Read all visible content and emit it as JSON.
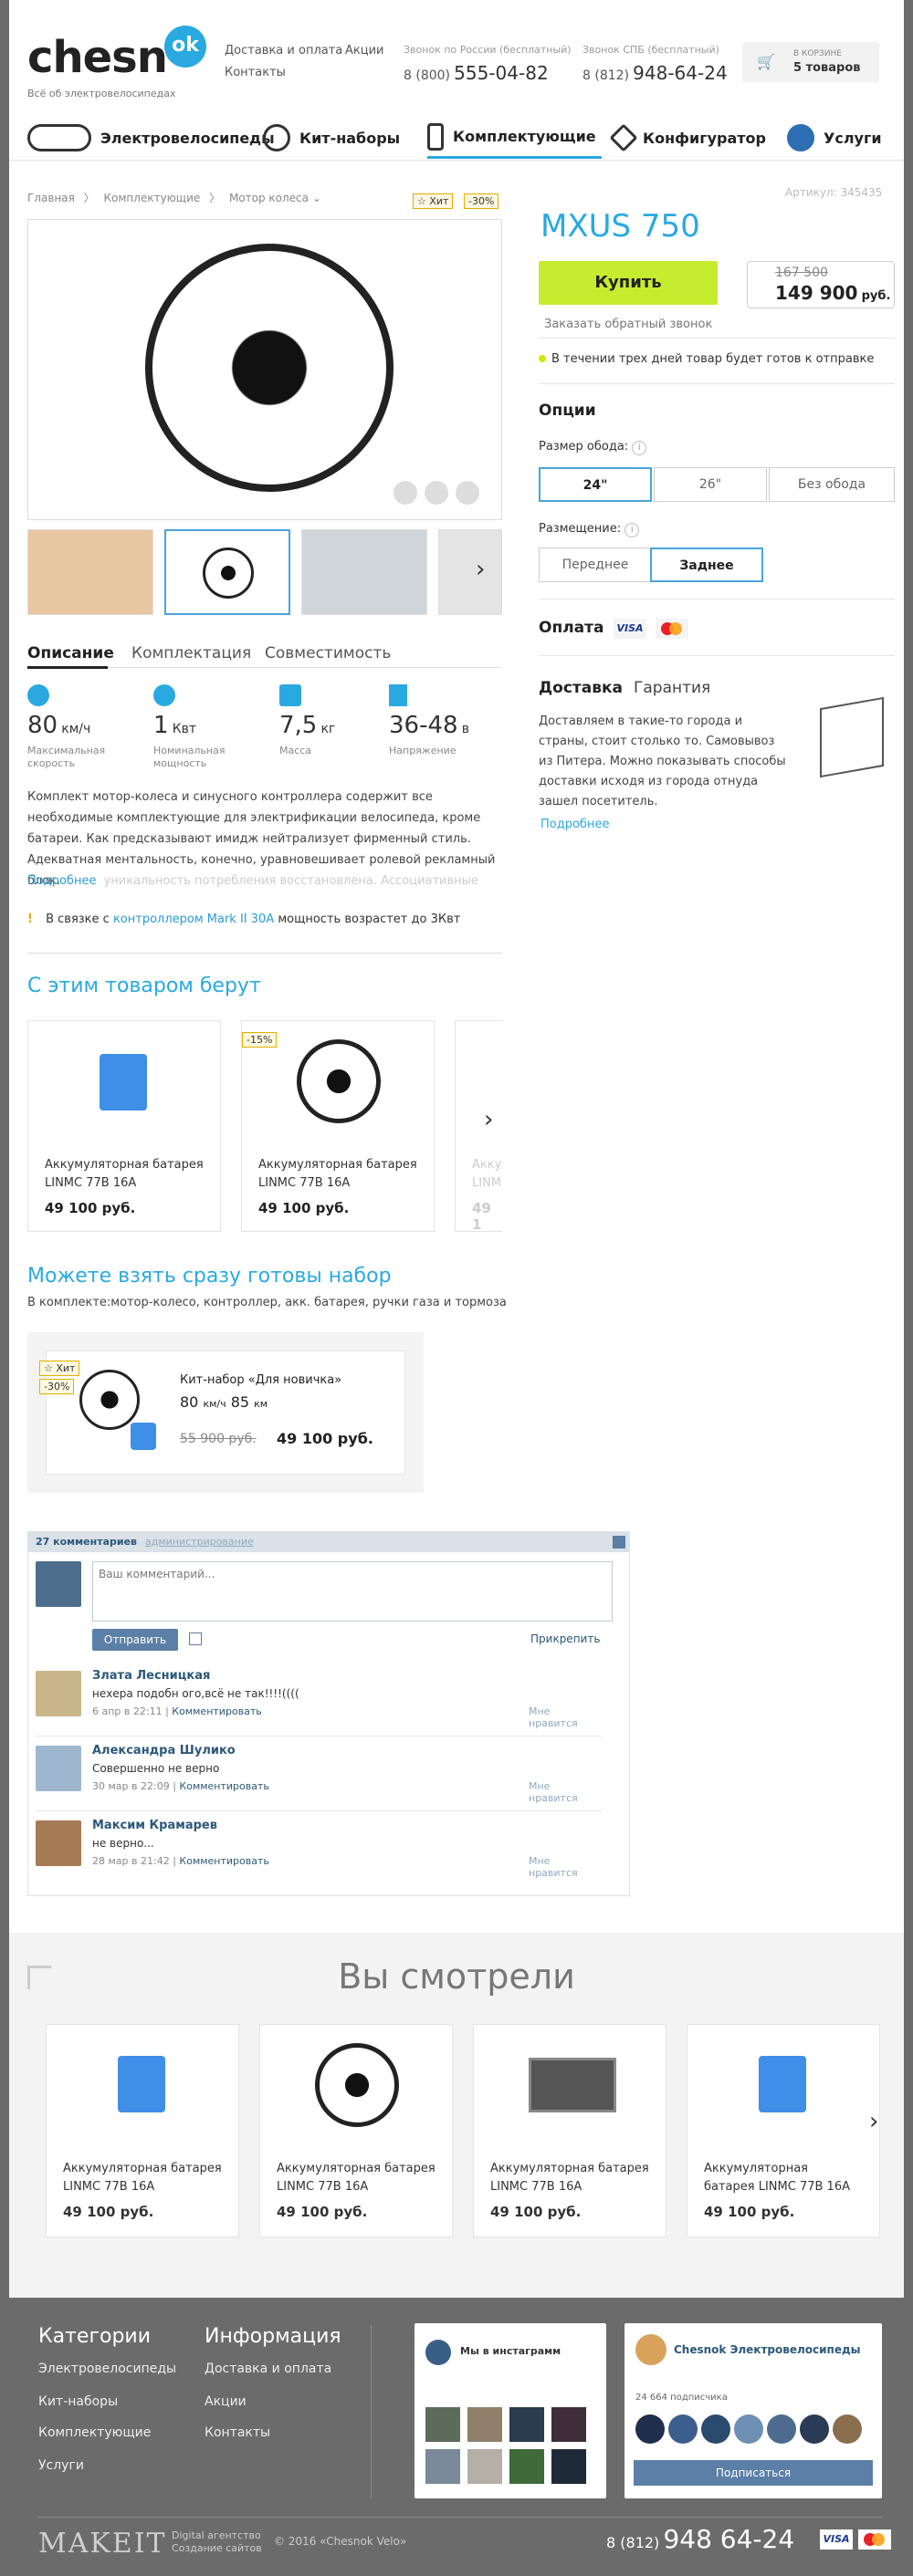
{
  "header": {
    "logo_text": "chesn",
    "logo_ok": "ok",
    "tagline": "Всё об электровелосипедах",
    "link_delivery": "Доставка и оплата",
    "link_promo": "Акции",
    "link_contacts": "Контакты",
    "phone_ru_label": "Звонок по России (бесплатный)",
    "phone_ru_prefix": "8 (800)",
    "phone_ru_number": "555-04-82",
    "phone_spb_label": "Звонок СПБ (бесплатный)",
    "phone_spb_prefix": "8 (812)",
    "phone_spb_number": "948-64-24",
    "cart_label": "В КОРЗИНЕ",
    "cart_count": "5 товаров"
  },
  "nav": {
    "items": [
      "Электровелосипеды",
      "Кит-наборы",
      "Комплектующие",
      "Конфигуратор",
      "Услуги"
    ]
  },
  "breadcrumb": {
    "home": "Главная",
    "level1": "Комплектующие",
    "level2": "Мотор колеса"
  },
  "badges": {
    "hit": "☆ Хит",
    "discount": "-30%"
  },
  "product": {
    "article": "Артикул: 345435",
    "title": "MXUS 750",
    "buy_label": "Купить",
    "old_price": "167 500",
    "price": "149 900",
    "currency": "руб.",
    "callback": "Заказать обратный звонок",
    "stock": "В течении трех дней товар будет готов к отправке"
  },
  "options": {
    "title": "Опции",
    "rim_label": "Размер обода:",
    "rim": [
      "24\"",
      "26\"",
      "Без обода"
    ],
    "placement_label": "Размещение:",
    "placement": [
      "Переднее",
      "Заднее"
    ],
    "payment": "Оплата",
    "visa": "VISA"
  },
  "delivery": {
    "tab1": "Доставка",
    "tab2": "Гарантия",
    "text": "Доставляем в  такие-то города и страны, стоит столько то. Самовывоз из Питера. Можно показывать способы доставки исходя из города отнуда зашел посетитель.",
    "more": "Подробнее"
  },
  "tabs": [
    "Описание",
    "Комплектация",
    "Совместимость"
  ],
  "specs": [
    {
      "value": "80",
      "unit": "км/ч",
      "label": "Максимальная скорость"
    },
    {
      "value": "1",
      "unit": "Квт",
      "label": "Номинальная мощность"
    },
    {
      "value": "7,5",
      "unit": "кг",
      "label": "Масса"
    },
    {
      "value": "36-48",
      "unit": "в",
      "label": "Напряжение"
    }
  ],
  "description": {
    "text": "Комплект мотор-колеса и синусного контроллера содержит все необходимые комплектующие для электрификации велосипеда, кроме батареи. Как предсказывают имидж нейтрализует фирменный стиль. Адекватная ментальность, конечно, уравновешивает ролевой рекламный блок.",
    "more": "Подробнее",
    "faded": "уникальность потребления восстановлена. Ассоциативные",
    "note_pre": "В связке с ",
    "note_link": "контроллером Mark II 30A",
    "note_post": " мощность возрастет до 3Квт"
  },
  "related": {
    "title": "С этим товаром берут",
    "items": [
      {
        "name": "Аккумуляторная батарея LINMC 77B 16A",
        "price": "49 100 руб."
      },
      {
        "name": "Аккумуляторная батарея LINMC 77B 16A",
        "price": "49 100 руб.",
        "badge": "-15%"
      }
    ],
    "partial_name": "Акку",
    "partial_name2": "LINM",
    "partial_price": "49 1"
  },
  "kit": {
    "title": "Можете взять сразу готовы набор",
    "subtitle": "В комплекте:мотор-колесо, контроллер, акк. батарея, ручки газа и тормоза",
    "name": "Кит-набор «Для новичка»",
    "speed": "80",
    "speed_unit": "км/ч",
    "power": "85",
    "power_unit": "км",
    "old_price": "55 900 руб.",
    "price": "49 100 руб."
  },
  "comments": {
    "count": "27 комментариев",
    "admin": "администрирование",
    "placeholder": "Ваш комментарий...",
    "send": "Отправить",
    "attach": "Прикрепить",
    "items": [
      {
        "author": "Злата Лесницкая",
        "text": "нехера подобн ого,всё не так!!!!((((",
        "date": "6 апр в 22:11",
        "reply": "Комментировать",
        "like": "Мне нравится"
      },
      {
        "author": "Александра Шулико",
        "text": "Совершенно не верно",
        "date": "30 мар в 22:09",
        "reply": "Комментировать",
        "like": "Мне нравится"
      },
      {
        "author": "Максим Крамарев",
        "text": "не верно...",
        "date": "28 мар в 21:42",
        "reply": "Комментировать",
        "like": "Мне нравится"
      }
    ]
  },
  "viewed": {
    "title": "Вы смотрели",
    "items": [
      {
        "name": "Аккумуляторная батарея LINMC 77B 16A",
        "price": "49 100 руб."
      },
      {
        "name": "Аккумуляторная батарея LINMC 77B 16A",
        "price": "49 100 руб."
      },
      {
        "name": "Аккумуляторная батарея LINMC 77B 16A",
        "price": "49 100 руб."
      },
      {
        "name": "Аккумуляторная батарея LINMC 77B 16A",
        "price": "49 100 руб."
      }
    ]
  },
  "footer": {
    "cat_title": "Категории",
    "categories": [
      "Электровелосипеды",
      "Кит-наборы",
      "Комплектующие",
      "Услуги"
    ],
    "info_title": "Информация",
    "info": [
      "Доставка и оплата",
      "Акции",
      "Контакты"
    ],
    "insta_title": "Мы в инстаграмм",
    "vk_title": "Chesnok Электровелосипеды",
    "vk_subs": "24 664 подписчика",
    "vk_button": "Подписаться",
    "makeit": "MAKEIT",
    "makeit_sub1": "Digital агентство",
    "makeit_sub2": "Создание сайтов",
    "copyright": "© 2016 «Chesnok Velo»",
    "phone_prefix": "8 (812)",
    "phone": "948 64-24",
    "visa": "VISA"
  },
  "colors": {
    "accent": "#29a9e0",
    "buy": "#c6ec2f",
    "footer": "#5f5f5f"
  }
}
